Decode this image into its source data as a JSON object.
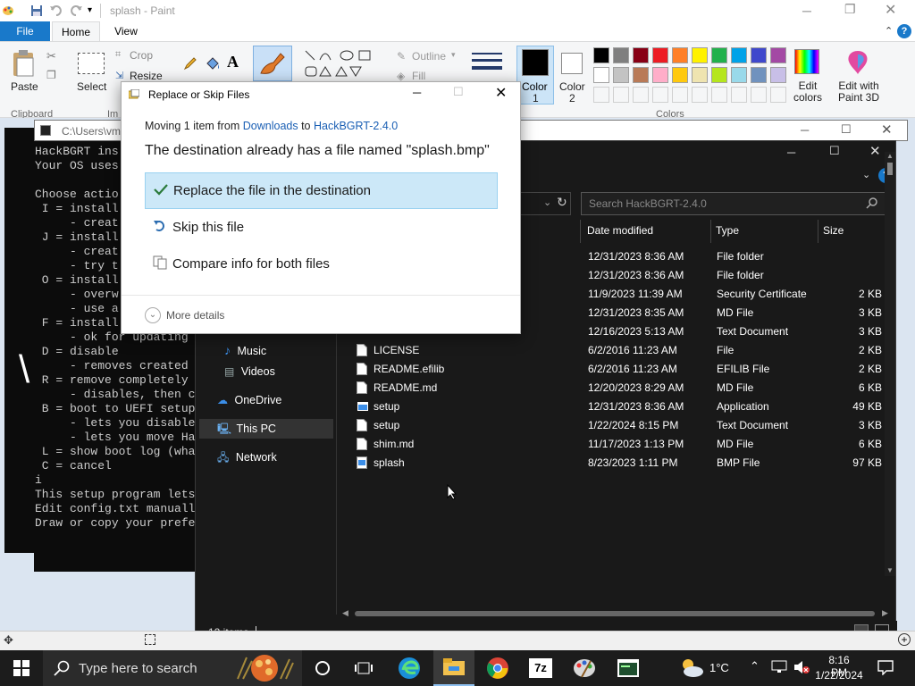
{
  "paint": {
    "title": "splash - Paint",
    "tabs": {
      "file": "File",
      "home": "Home",
      "view": "View"
    },
    "ribbon": {
      "paste": "Paste",
      "select": "Select",
      "crop": "Crop",
      "resize": "Resize",
      "outline": "Outline",
      "fill": "Fill",
      "color1": "Color",
      "color1_num": "1",
      "color2": "Color",
      "color2_num": "2",
      "edit_colors": "Edit colors",
      "edit_paint3d": "Edit with Paint 3D",
      "clipboard_group": "Clipboard",
      "image_group": "Im",
      "colors_group": "Colors"
    },
    "palette_row1": [
      "#000000",
      "#7f7f7f",
      "#880015",
      "#ed1c24",
      "#ff7f27",
      "#fff200",
      "#22b14c",
      "#00a2e8",
      "#3f48cc",
      "#a349a4"
    ],
    "palette_row2": [
      "#ffffff",
      "#c3c3c3",
      "#b97a57",
      "#ffaec9",
      "#ffc90e",
      "#efe4b0",
      "#b5e61d",
      "#99d9ea",
      "#7092be",
      "#c8bfe7"
    ]
  },
  "console": {
    "title": "C:\\Users\\vm",
    "lines": [
      "HackBGRT ins",
      "Your OS uses",
      "",
      "Choose actio",
      " I = install",
      "     - creat",
      " J = install",
      "     - creat",
      "     - try t",
      " O = install",
      "     - overw",
      "     - use a",
      " F = install",
      "     - ok for updating",
      " D = disable",
      "     - removes created",
      " R = remove completely",
      "     - disables, then c",
      " B = boot to UEFI setup",
      "     - lets you disable",
      "     - lets you move Ha",
      " L = show boot log (wha",
      " C = cancel",
      "i",
      "This setup program lets",
      "Edit config.txt manuall",
      "Draw or copy your prefe"
    ]
  },
  "explorer": {
    "search_placeholder": "Search HackBGRT-2.4.0",
    "columns": {
      "date": "Date modified",
      "type": "Type",
      "size": "Size"
    },
    "nav": {
      "music": "Music",
      "videos": "Videos",
      "onedrive": "OneDrive",
      "thispc": "This PC",
      "network": "Network"
    },
    "status": "12 items",
    "files": [
      {
        "name": "",
        "date": "12/31/2023 8:36 AM",
        "type": "File folder",
        "size": ""
      },
      {
        "name": "",
        "date": "12/31/2023 8:36 AM",
        "type": "File folder",
        "size": ""
      },
      {
        "name": "",
        "date": "11/9/2023 11:39 AM",
        "type": "Security Certificate",
        "size": "2 KB"
      },
      {
        "name": "",
        "date": "12/31/2023 8:35 AM",
        "type": "MD File",
        "size": "3 KB"
      },
      {
        "name": "",
        "date": "12/16/2023 5:13 AM",
        "type": "Text Document",
        "size": "3 KB"
      },
      {
        "name": "LICENSE",
        "date": "6/2/2016 11:23 AM",
        "type": "File",
        "size": "2 KB"
      },
      {
        "name": "README.efilib",
        "date": "6/2/2016 11:23 AM",
        "type": "EFILIB File",
        "size": "2 KB"
      },
      {
        "name": "README.md",
        "date": "12/20/2023 8:29 AM",
        "type": "MD File",
        "size": "6 KB"
      },
      {
        "name": "setup",
        "date": "12/31/2023 8:36 AM",
        "type": "Application",
        "size": "49 KB"
      },
      {
        "name": "setup",
        "date": "1/22/2024 8:15 PM",
        "type": "Text Document",
        "size": "3 KB"
      },
      {
        "name": "shim.md",
        "date": "11/17/2023 1:13 PM",
        "type": "MD File",
        "size": "6 KB"
      },
      {
        "name": "splash",
        "date": "8/23/2023 1:11 PM",
        "type": "BMP File",
        "size": "97 KB"
      }
    ]
  },
  "dialog": {
    "title": "Replace or Skip Files",
    "moving_prefix": "Moving 1 item from ",
    "source": "Downloads",
    "to": " to ",
    "dest": "HackBGRT-2.4.0",
    "message": "The destination already has a file named \"splash.bmp\"",
    "option_replace": "Replace the file in the destination",
    "option_skip": "Skip this file",
    "option_compare": "Compare info for both files",
    "more_details": "More details"
  },
  "taskbar": {
    "search": "Type here to search",
    "weather": "1°C",
    "time": "8:16 PM",
    "date": "1/22/2024"
  }
}
